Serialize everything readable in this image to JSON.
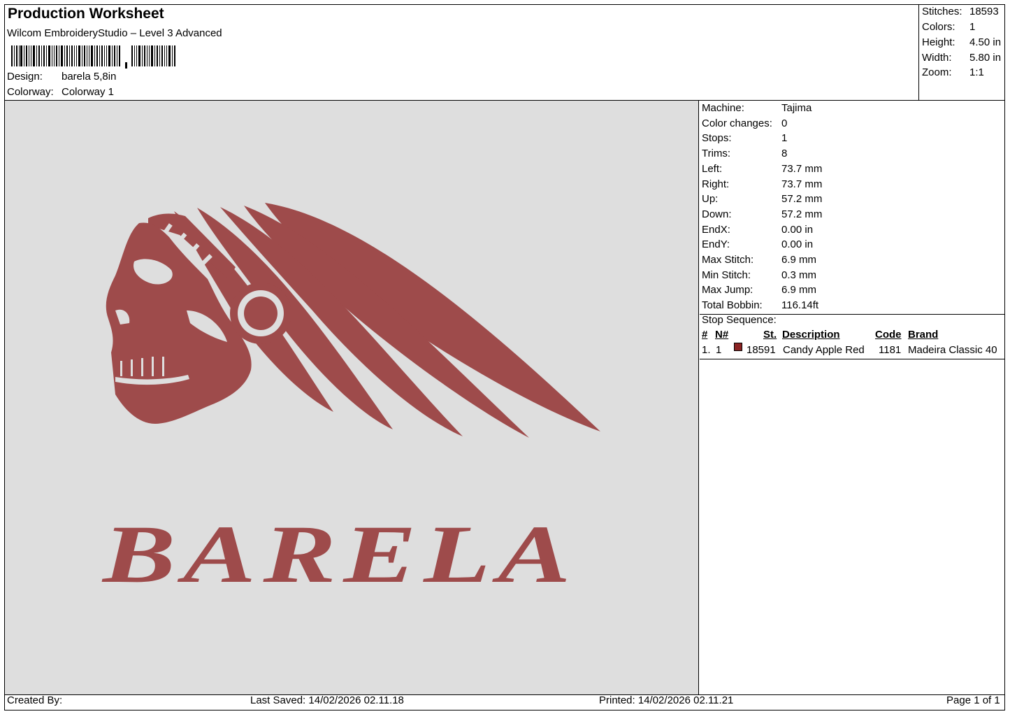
{
  "header": {
    "title": "Production Worksheet",
    "subtitle": "Wilcom EmbroideryStudio – Level 3 Advanced",
    "design_label": "Design:",
    "design_value": "barela 5,8in",
    "colorway_label": "Colorway:",
    "colorway_value": "Colorway 1"
  },
  "summary": {
    "stitches_label": "Stitches:",
    "stitches_value": "18593",
    "colors_label": "Colors:",
    "colors_value": "1",
    "height_label": "Height:",
    "height_value": "4.50 in",
    "width_label": "Width:",
    "width_value": "5.80 in",
    "zoom_label": "Zoom:",
    "zoom_value": "1:1"
  },
  "machine_info": [
    {
      "label": "Machine:",
      "value": "Tajima"
    },
    {
      "label": "Color changes:",
      "value": "0"
    },
    {
      "label": "Stops:",
      "value": "1"
    },
    {
      "label": "Trims:",
      "value": "8"
    },
    {
      "label": "Left:",
      "value": "73.7 mm"
    },
    {
      "label": "Right:",
      "value": "73.7 mm"
    },
    {
      "label": "Up:",
      "value": "57.2 mm"
    },
    {
      "label": "Down:",
      "value": "57.2 mm"
    },
    {
      "label": "EndX:",
      "value": "0.00 in"
    },
    {
      "label": "EndY:",
      "value": "0.00 in"
    },
    {
      "label": "Max Stitch:",
      "value": "6.9 mm"
    },
    {
      "label": "Min Stitch:",
      "value": "0.3 mm"
    },
    {
      "label": "Max Jump:",
      "value": "6.9 mm"
    },
    {
      "label": "Total Bobbin:",
      "value": "116.14ft"
    }
  ],
  "stop_sequence": {
    "title": "Stop Sequence:",
    "headers": {
      "num": "#",
      "n": "N#",
      "st": "St.",
      "description": "Description",
      "code": "Code",
      "brand": "Brand"
    },
    "rows": [
      {
        "num": "1.",
        "n": "1",
        "color": "#8b2323",
        "st": "18591",
        "description": "Candy Apple Red",
        "code": "1181",
        "brand": "Madeira Classic 40"
      }
    ]
  },
  "design_preview": {
    "text": "BARELA",
    "thread_color": "#9e4b4b",
    "background": "#dedede"
  },
  "footer": {
    "created_by": "Created By:",
    "last_saved": "Last Saved: 14/02/2026 02.11.18",
    "printed": "Printed: 14/02/2026 02.11.21",
    "page": "Page 1 of 1"
  }
}
